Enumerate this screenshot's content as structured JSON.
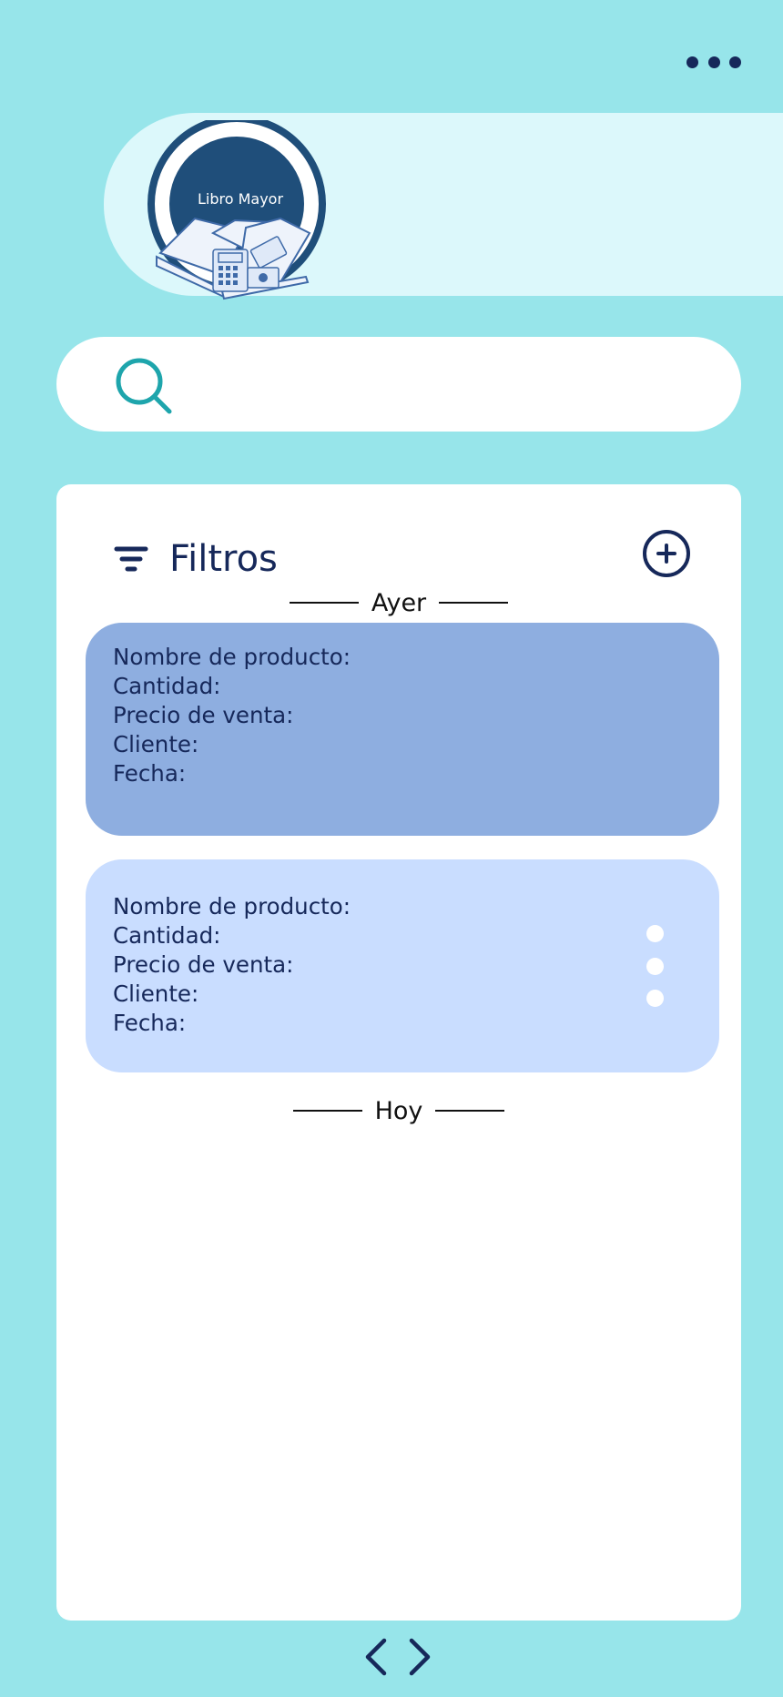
{
  "header": {
    "more_icon": "more-horizontal-icon",
    "logo_text": "Libro Mayor"
  },
  "search": {
    "icon": "search-icon",
    "placeholder": "",
    "value": ""
  },
  "panel": {
    "filter_label": "Filtros",
    "filter_icon": "filter-icon",
    "add_icon": "plus-circle-icon",
    "sections": [
      {
        "label": "Ayer",
        "cards": [
          {
            "fields": [
              "Nombre de producto:",
              "Cantidad:",
              "Precio de venta:",
              "Cliente:",
              "Fecha:"
            ]
          },
          {
            "fields": [
              "Nombre de producto:",
              "Cantidad:",
              "Precio de venta:",
              "Cliente:",
              "Fecha:"
            ],
            "menu_icon": "more-vertical-icon"
          }
        ]
      },
      {
        "label": "Hoy",
        "cards": []
      }
    ]
  },
  "pager": {
    "prev_icon": "chevron-left-icon",
    "next_icon": "chevron-right-icon"
  },
  "colors": {
    "background": "#97e5ea",
    "header_band": "#dcf8fb",
    "text_dark": "#16285a",
    "card_selected": "#8eaee0",
    "card_default": "#c9ddff",
    "accent_teal": "#1ea5ac",
    "logo_navy": "#1f4e7a"
  }
}
